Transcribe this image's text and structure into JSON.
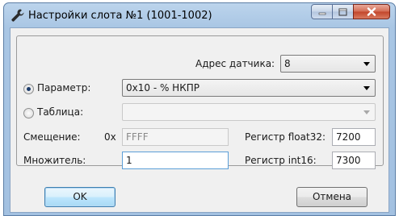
{
  "window": {
    "title": "Настройки слота №1 (1001-1002)"
  },
  "form": {
    "sensor_address_label": "Адрес датчика:",
    "sensor_address_value": "8",
    "parameter_label": "Параметр:",
    "parameter_value": "0x10 - % НКПР",
    "parameter_selected": true,
    "table_label": "Таблица:",
    "table_value": "",
    "table_selected": false,
    "offset_label": "Смещение:",
    "offset_prefix": "0x",
    "offset_value": "FFFF",
    "multiplier_label": "Множитель:",
    "multiplier_value": "1",
    "float32_label": "Регистр float32:",
    "float32_value": "7200",
    "int16_label": "Регистр int16:",
    "int16_value": "7300"
  },
  "buttons": {
    "ok_label": "OK",
    "cancel_label": "Отмена"
  },
  "colors": {
    "title_bar": "#a9c6e4",
    "close_button": "#c2452b",
    "radio_dot": "#1d3d6b"
  }
}
